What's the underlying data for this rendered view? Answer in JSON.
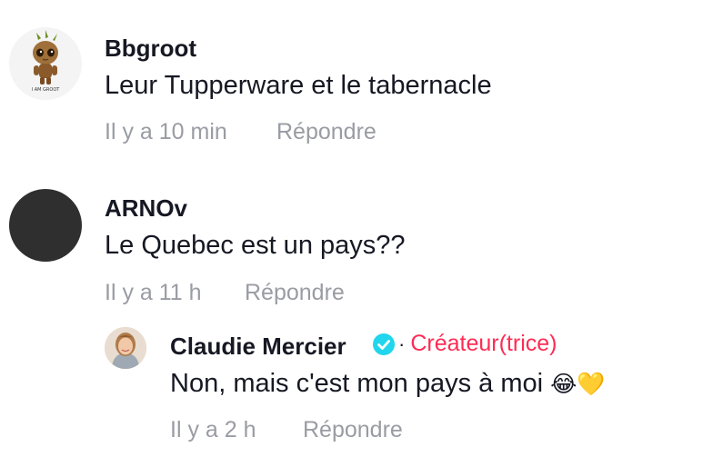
{
  "comments": [
    {
      "username": "Bbgroot",
      "avatar_caption": "I AM GROOT",
      "text": "Leur Tupperware et le tabernacle",
      "time": "Il y a 10 min",
      "reply_label": "Répondre"
    },
    {
      "username": "ARNOv",
      "text": "Le Quebec est un pays??",
      "time": "Il y a 11 h",
      "reply_label": "Répondre",
      "replies": [
        {
          "username": "Claudie Mercier",
          "creator_label": "Créateur(trice)",
          "text": "Non, mais c'est mon pays à moi",
          "emojis": "😂💛",
          "time": "Il y a 2 h",
          "reply_label": "Répondre"
        }
      ]
    }
  ],
  "colors": {
    "creator_accent": "#fe2c55",
    "verified_badge": "#20d5ec",
    "meta_text": "#9a9ca3",
    "dark_avatar": "#2f2f2f"
  }
}
